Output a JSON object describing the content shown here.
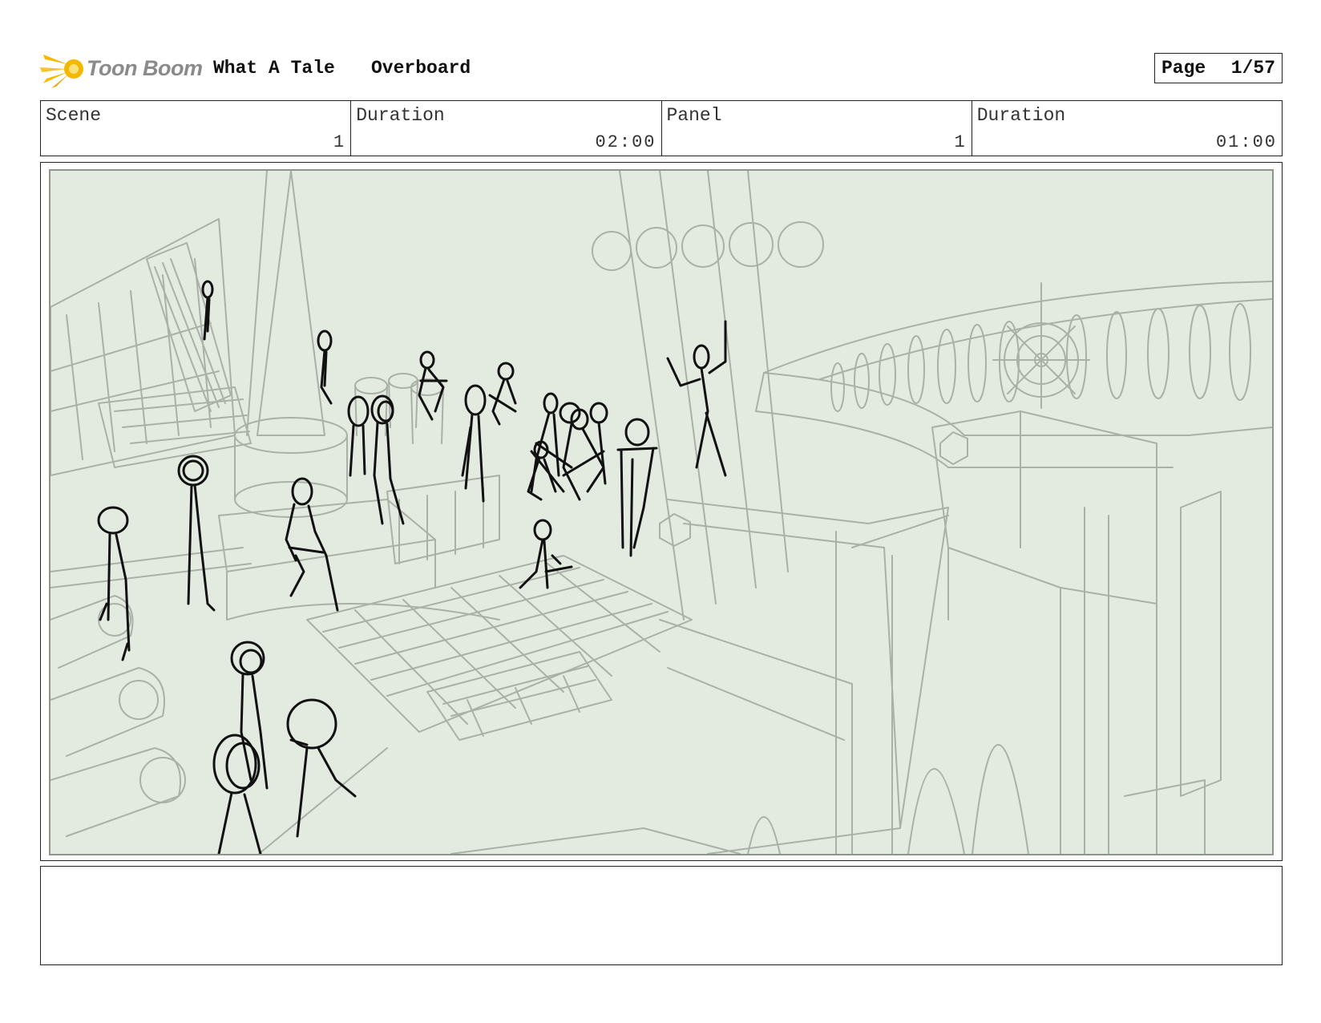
{
  "header": {
    "logo_text": "Toon Boom",
    "project_title": "What A Tale",
    "episode_title": "Overboard",
    "page_label": "Page",
    "page_number": "1/57"
  },
  "info_bar": {
    "scene_label": "Scene",
    "scene_value": "1",
    "scene_duration_label": "Duration",
    "scene_duration_value": "02:00",
    "panel_label": "Panel",
    "panel_value": "1",
    "panel_duration_label": "Duration",
    "panel_duration_value": "01:00"
  },
  "panel": {
    "background_color": "#e3ebe1",
    "line_color": "#a9b1a7",
    "figure_color": "#111111"
  },
  "colors": {
    "logo_star": "#f5b800",
    "logo_text": "#8a8a8a",
    "border": "#222222"
  }
}
